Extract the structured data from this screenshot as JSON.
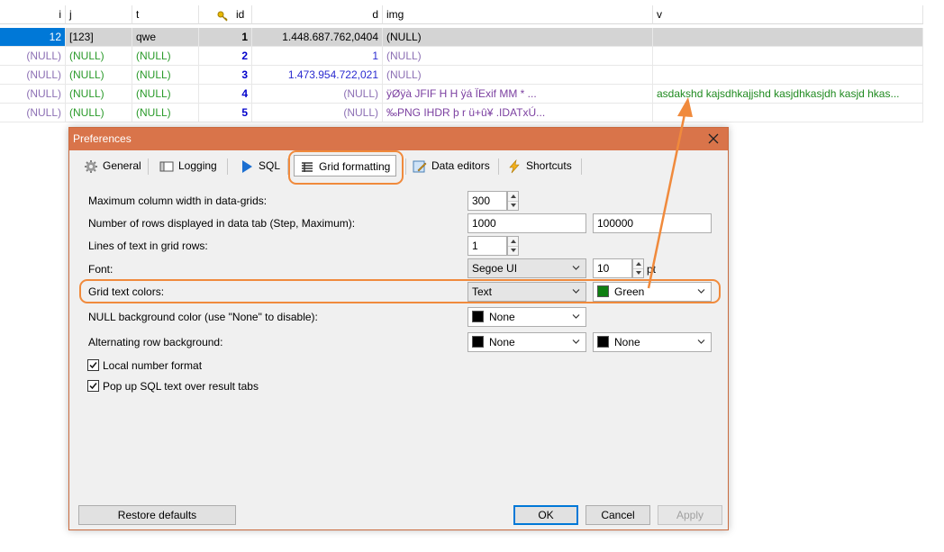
{
  "grid": {
    "headers": {
      "i": "i",
      "j": "j",
      "t": "t",
      "id": "id",
      "d": "d",
      "img": "img",
      "v": "v"
    },
    "rows": [
      {
        "i": "12",
        "j": "[123]",
        "t": "qwe",
        "id": "1",
        "d": "1.448.687.762,0404",
        "img": "(NULL)",
        "v": ""
      },
      {
        "i": "(NULL)",
        "j": "(NULL)",
        "t": "(NULL)",
        "id": "2",
        "d": "1",
        "img": "(NULL)",
        "v": ""
      },
      {
        "i": "(NULL)",
        "j": "(NULL)",
        "t": "(NULL)",
        "id": "3",
        "d": "1.473.954.722,021",
        "img": "(NULL)",
        "v": ""
      },
      {
        "i": "(NULL)",
        "j": "(NULL)",
        "t": "(NULL)",
        "id": "4",
        "d": "(NULL)",
        "img": "ÿØÿà  JFIF      H  H    ÿá  ÏExif    MM  *       ...",
        "v": "asdakshd kajsdhkajjshd kasjdhkasjdh kasjd hkas..."
      },
      {
        "i": "(NULL)",
        "j": "(NULL)",
        "t": "(NULL)",
        "id": "5",
        "d": "(NULL)",
        "img": "‰PNG      IHDR      þ    r      ü+û¥  .IDATxÚ...",
        "v": ""
      }
    ]
  },
  "dialog": {
    "title": "Preferences",
    "tabs": [
      {
        "label": "General",
        "icon": "gear-icon"
      },
      {
        "label": "Logging",
        "icon": "logging-icon"
      },
      {
        "label": "SQL",
        "icon": "play-icon"
      },
      {
        "label": "Grid formatting",
        "icon": "grid-icon"
      },
      {
        "label": "Data editors",
        "icon": "editor-icon"
      },
      {
        "label": "Shortcuts",
        "icon": "lightning-icon"
      }
    ],
    "fields": {
      "max_col_width_label": "Maximum column width in data-grids:",
      "max_col_width": "300",
      "rows_label": "Number of rows displayed in data tab (Step, Maximum):",
      "rows_step": "1000",
      "rows_max": "100000",
      "lines_label": "Lines of text in grid rows:",
      "lines": "1",
      "font_label": "Font:",
      "font_name": "Segoe UI",
      "font_size": "10",
      "font_unit": "pt",
      "grid_text_colors_label": "Grid text colors:",
      "grid_text_kind": "Text",
      "grid_text_color": "Green",
      "null_bg_label": "NULL background color (use \"None\" to disable):",
      "null_bg": "None",
      "alt_row_label": "Alternating row background:",
      "alt_row_1": "None",
      "alt_row_2": "None",
      "local_number_label": "Local number format",
      "local_number_checked": true,
      "popup_sql_label": "Pop up SQL text over result tabs",
      "popup_sql_checked": true
    },
    "buttons": {
      "restore": "Restore defaults",
      "ok": "OK",
      "cancel": "Cancel",
      "apply": "Apply"
    }
  },
  "colors": {
    "titlebar": "#d9744a",
    "highlight": "#f08a3c",
    "green_swatch": "#0f7f12",
    "black_swatch": "#000000",
    "selection": "#0078d7"
  }
}
